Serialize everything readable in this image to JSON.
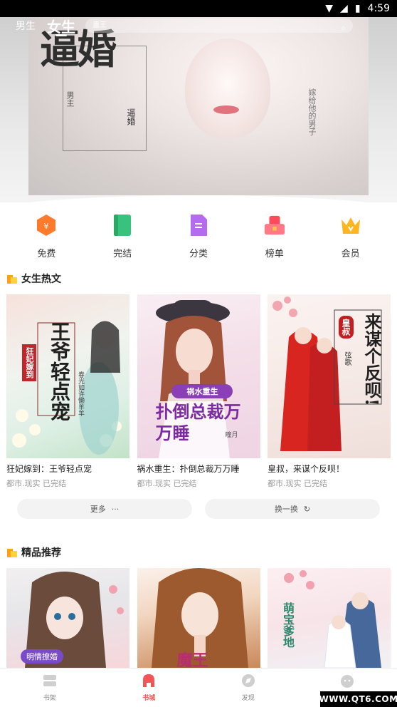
{
  "status_bar": {
    "time": "4:59",
    "battery": "🔋"
  },
  "top_nav": {
    "tab_male": "男生",
    "tab_female": "女生",
    "search_placeholder": "蛊王"
  },
  "hero": {
    "cover_title": "逼婚",
    "cover_subtitle": "逼婚",
    "cover_author": "男主",
    "cover_side_text": "嫁给他的男子"
  },
  "categories": [
    {
      "label": "免费",
      "icon": "coin-hexagon-icon",
      "color": "#ff7a2a"
    },
    {
      "label": "完结",
      "icon": "book-icon",
      "color": "#37c37d"
    },
    {
      "label": "分类",
      "icon": "document-icon",
      "color": "#b56bf0"
    },
    {
      "label": "榜单",
      "icon": "ranking-icon",
      "color": "#ff4a5a"
    },
    {
      "label": "会员",
      "icon": "crown-icon",
      "color": "#ffb51f"
    }
  ],
  "section_hot": {
    "title": "女生热文",
    "books": [
      {
        "title": "狂妃嫁到：王爷轻点宠",
        "meta": "都市.现实 已完结",
        "cover_text": "王爷轻点宠",
        "cover_tag": "狂妃嫁到",
        "cover_author": "春光如许懒羊羊"
      },
      {
        "title": "祸水重生：扑倒总裁万万睡",
        "meta": "都市.现实 已完结",
        "cover_text": "扑倒总裁万万睡",
        "cover_tag": "祸水重生",
        "cover_author": "瞳月"
      },
      {
        "title": "皇叔，来谋个反呗！",
        "meta": "都市.现实 已完结",
        "cover_text": "来谋个反呗!",
        "cover_tag": "皇叔",
        "cover_author": "弦歌"
      }
    ],
    "more_label": "更多",
    "more_icon": "···",
    "refresh_label": "换一换",
    "refresh_icon": "↻"
  },
  "section_featured": {
    "title": "精品推荐",
    "books": [
      {
        "cover_text": "明情撩婚"
      },
      {
        "cover_text": "魔王"
      },
      {
        "cover_text": "萌宝爹地"
      }
    ]
  },
  "bottom_nav": [
    {
      "label": "书架",
      "icon": "bookshelf-icon",
      "active": false
    },
    {
      "label": "书城",
      "icon": "bookstore-icon",
      "active": true
    },
    {
      "label": "发现",
      "icon": "discover-icon",
      "active": false
    },
    {
      "label": "我的",
      "icon": "profile-icon",
      "active": false
    }
  ],
  "watermark": "WWW.QT6.COM",
  "colors": {
    "accent": "#f05656",
    "section_flag": "#ffa21a"
  }
}
